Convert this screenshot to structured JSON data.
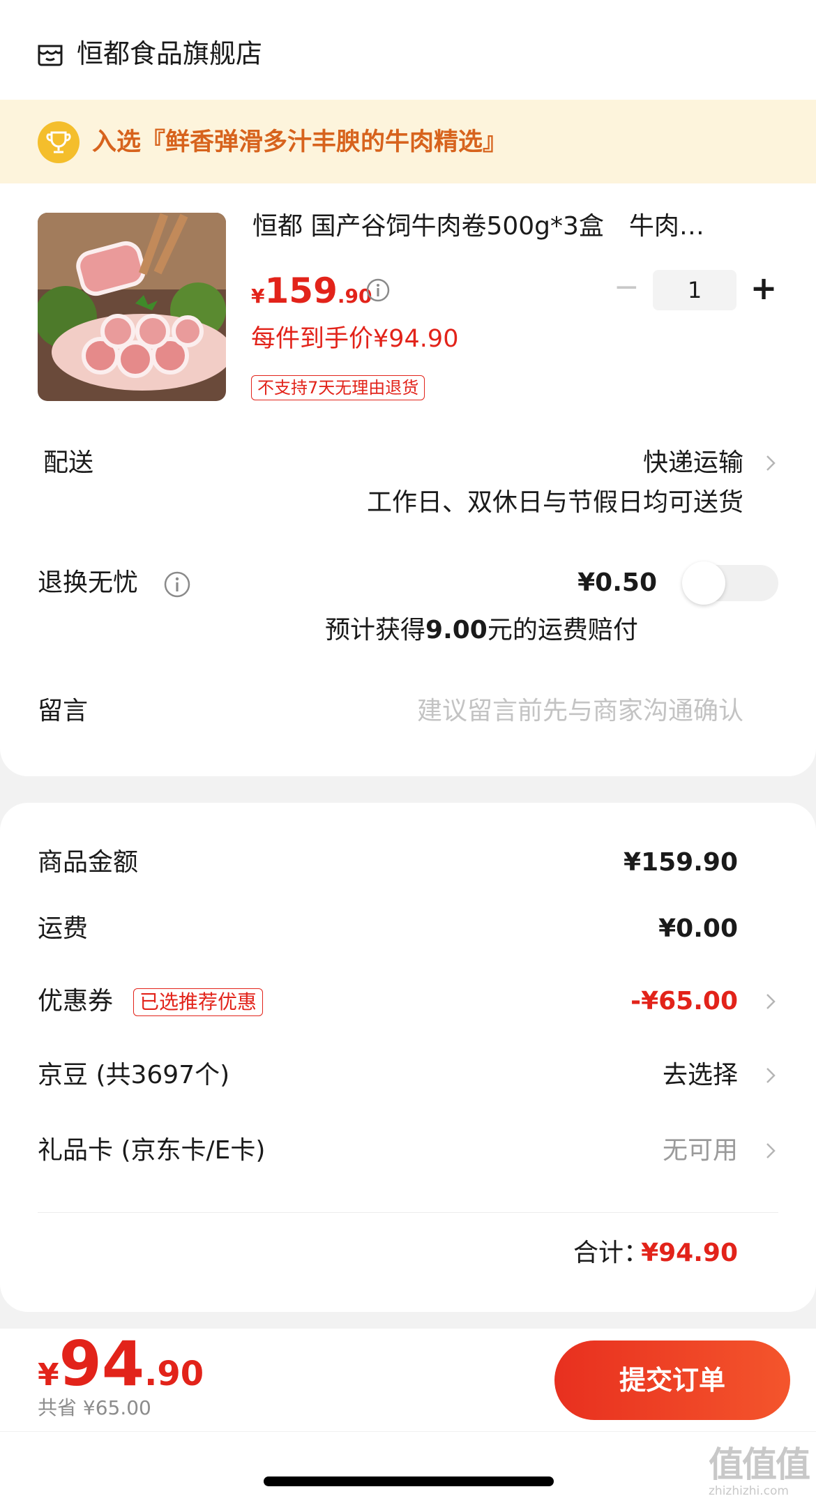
{
  "store": {
    "name": "恒都食品旗舰店",
    "icon": "store-icon"
  },
  "banner": {
    "text": "入选『鲜香弹滑多汁丰腴的牛肉精选』",
    "icon": "trophy-icon"
  },
  "product": {
    "title": "恒都 国产谷饲牛肉卷500g*3盒　牛肉…",
    "price_currency": "¥",
    "price_int": "159",
    "price_dec": ".90",
    "unit_price": "每件到手价¥94.90",
    "return_policy": "不支持7天无理由退货",
    "quantity": "1",
    "minus": "−",
    "plus": "+"
  },
  "delivery": {
    "label": "配送",
    "method": "快递运输",
    "note": "工作日、双休日与节假日均可送货"
  },
  "return_insurance": {
    "label": "退换无忧",
    "price": "¥0.50",
    "enabled": false,
    "compensation_pre": "预计获得",
    "compensation_amount": "9.00",
    "compensation_post": "元的运费赔付"
  },
  "message": {
    "label": "留言",
    "placeholder": "建议留言前先与商家沟通确认"
  },
  "summary": {
    "goods_label": "商品金额",
    "goods_value": "¥159.90",
    "shipping_label": "运费",
    "shipping_value": "¥0.00",
    "coupon_label": "优惠券",
    "coupon_tag": "已选推荐优惠",
    "coupon_value": "-¥65.00",
    "jingdou_label": "京豆 (共3697个)",
    "jingdou_value": "去选择",
    "giftcard_label": "礼品卡 (京东卡/E卡)",
    "giftcard_value": "无可用",
    "total_label": "合计：",
    "total_value": "¥94.90"
  },
  "bottom": {
    "currency": "¥",
    "price_int": "94",
    "price_dec": ".90",
    "saved": "共省 ¥65.00",
    "submit_label": "提交订单"
  },
  "watermark": {
    "big": "值值值",
    "small": "zhizhizhi.com"
  },
  "colors": {
    "accent": "#e2231a",
    "banner_bg": "#fdf4dc",
    "banner_text": "#d7631d",
    "page_bg": "#f2f2f2"
  }
}
